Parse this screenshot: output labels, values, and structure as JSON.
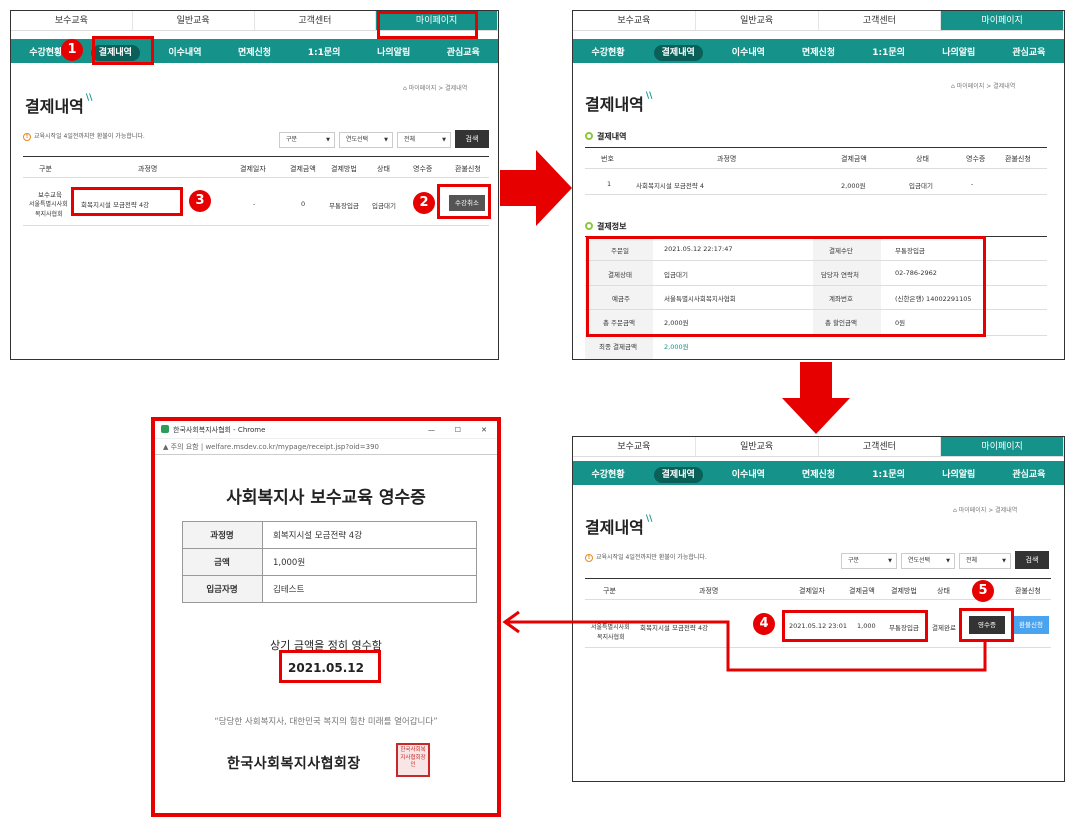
{
  "top_menu": [
    "보수교육",
    "일반교육",
    "고객센터",
    "마이페이지"
  ],
  "sub_menu_a": [
    "수강현황",
    "결제내역",
    "이수내역",
    "면제신청",
    "1:1문의",
    "나의알림",
    "관심교육"
  ],
  "sub_menu_b": [
    "수강현황",
    "결제내역",
    "이수내역",
    "면제신청",
    "1:1문의",
    "나의알림",
    "관심교육"
  ],
  "page_title": "결제내역",
  "breadcrumb": "마이페이지 > 결제내역",
  "refund_note": "교육시작일 4일전까지만 환불이 가능합니다.",
  "filters": {
    "type": "구분",
    "year": "연도선택",
    "scope": "전체",
    "search_button": "검색"
  },
  "list_headers": [
    "구분",
    "과정명",
    "결제일자",
    "결제금액",
    "결제방법",
    "상태",
    "영수증",
    "환불신청"
  ],
  "list_row_1": {
    "category": "보수교육",
    "org_line1": "서울특별시사회",
    "org_line2": "복지사협회",
    "course": "회복지시설 모금전략 4강",
    "date": "-",
    "amount": "0",
    "method": "무통장입금",
    "status": "입금대기",
    "action": "수강취소"
  },
  "order_section": {
    "title": "결제내역",
    "headers": [
      "번호",
      "과정명",
      "결제금액",
      "상태",
      "영수증",
      "환불신청"
    ],
    "row": {
      "no": "1",
      "course": "사회복지시설 모금전략 4",
      "amount": "2,000원",
      "status": "입금대기",
      "receipt": "-"
    }
  },
  "payment_info": {
    "title": "결제정보",
    "order_date_label": "주문일",
    "order_date": "2021.05.12 22:17:47",
    "pay_method_label": "결제수단",
    "pay_method": "무통장입금",
    "pay_status_label": "결제상태",
    "pay_status": "입금대기",
    "contact_label": "담당자 연락처",
    "contact": "02-786-2962",
    "depositor_label": "예금주",
    "depositor": "서울특별시사회복지사협회",
    "account_label": "계좌번호",
    "account": "(신한은행) 14002291105",
    "total_label": "총 주문금액",
    "total": "2,000원",
    "discount_label": "총 할인금액",
    "discount": "0원",
    "final_label": "최종 결제금액",
    "final": "2,000원"
  },
  "list_row_2": {
    "org_line1": "서울특별시사회",
    "org_line2": "복지사협회",
    "course": "회복지시설 모금전략 4강",
    "date": "2021.05.12 23:01",
    "amount": "1,000",
    "method": "무통장입금",
    "status": "결제완료",
    "receipt_button": "영수증",
    "refund_button": "환불신청"
  },
  "receipt": {
    "window_title": "한국사회복지사협회 - Chrome",
    "url_label": "주의 요함",
    "url": "welfare.msdev.co.kr/mypage/receipt.jsp?oid=390",
    "heading": "사회복지사 보수교육 영수증",
    "course_label": "과정명",
    "course": "회복지시설 모금전략 4강",
    "amount_label": "금액",
    "amount": "1,000원",
    "payer_label": "입금자명",
    "payer": "김테스트",
    "confirm_text": "상기 금액을 정히 영수함",
    "date": "2021.05.12",
    "slogan": "“당당한 사회복지사, 대한민국 복지의 힘찬 미래를 열어갑니다”",
    "signature": "한국사회복지사협회장",
    "seal_text": "한국사회복지사협회장인"
  },
  "steps": [
    "1",
    "2",
    "3",
    "4",
    "5"
  ],
  "colors": {
    "brand": "#15938a",
    "highlight": "#e60000",
    "arrow": "#e60000"
  }
}
